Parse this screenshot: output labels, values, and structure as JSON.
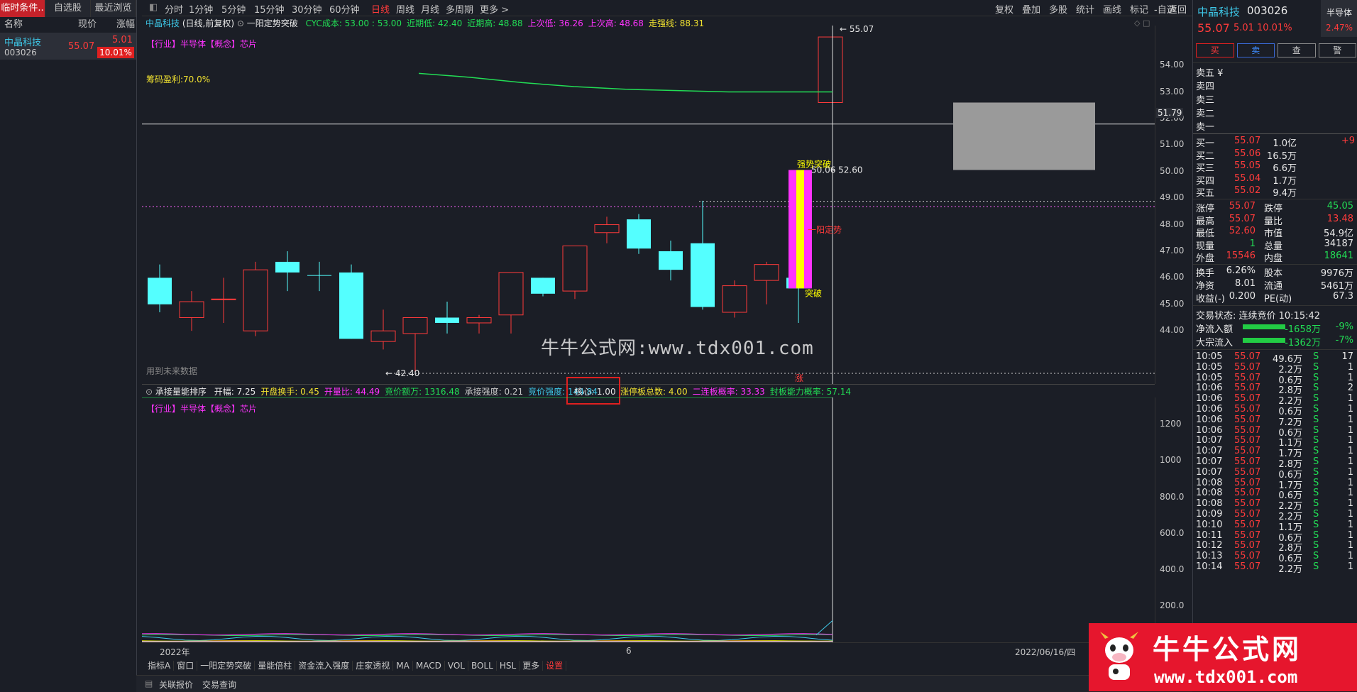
{
  "left": {
    "tabs": [
      "临时条件..",
      "自选股",
      "最近浏览"
    ],
    "headers": [
      "名称",
      "现价",
      "涨幅"
    ],
    "stock": {
      "name": "中晶科技",
      "code": "003026",
      "price": "55.07",
      "change": "5.01",
      "pct": "10.01%"
    }
  },
  "toolbar": {
    "periods": [
      "分时",
      "1分钟",
      "5分钟",
      "15分钟",
      "30分钟",
      "60分钟",
      "日线",
      "周线",
      "月线",
      "多周期",
      "更多 >"
    ],
    "right_buttons": [
      "复权",
      "叠加",
      "多股",
      "统计",
      "画线",
      "标记",
      "-自选",
      "返回"
    ]
  },
  "main_chart": {
    "title": "中晶科技",
    "subtitle": "(日线,前复权)",
    "indicator": "一阳定势突破",
    "stats": [
      {
        "label": "CYC成本: 53.00 : 53.00",
        "color": "#22dd55"
      },
      {
        "label": "近期低: 42.40",
        "color": "#22dd55"
      },
      {
        "label": "近期高: 48.88",
        "color": "#22dd55"
      },
      {
        "label": "上次低: 36.26",
        "color": "#ff33ff"
      },
      {
        "label": "上次高: 48.68",
        "color": "#ff33ff"
      },
      {
        "label": "走强线: 88.31",
        "color": "#f0e130"
      }
    ],
    "sector": "【行业】半导体【概念】芯片",
    "chip_profit": "筹码盈利:70.0%",
    "future_note": "用到未来数据",
    "high_label": "55.07",
    "low_label": "42.40",
    "crosshair_value": "51.79",
    "box_label": "50.06",
    "box_price": "52.60",
    "strong_break": "强势突破",
    "yiyang": "一阳定势",
    "tupo": "突破",
    "zhang": "涨",
    "yaxis": [
      "54.00",
      "53.00",
      "52.00",
      "51.00",
      "50.00",
      "49.00",
      "48.00",
      "47.00",
      "46.00",
      "45.00",
      "44.00"
    ]
  },
  "sub_chart": {
    "title": "承接量能排序",
    "stats": [
      {
        "label": "开幅: 7.25",
        "color": "#e8e8e8"
      },
      {
        "label": "开盘换手: 0.45",
        "color": "#f0e130"
      },
      {
        "label": "开量比: 44.49",
        "color": "#ff33ff"
      },
      {
        "label": "竞价额万: 1316.48",
        "color": "#22dd55"
      },
      {
        "label": "承接强度: 0.21",
        "color": "#c8c8c8"
      },
      {
        "label": "竞价强度: 144.84",
        "color": "#3ec8e8"
      }
    ],
    "core": "核心: 1.00",
    "stats2": [
      {
        "label": "涨停板总数: 4.00",
        "color": "#f0e130"
      },
      {
        "label": "二连板概率: 33.33",
        "color": "#ff33ff"
      },
      {
        "label": "封板能力概率: 57.14",
        "color": "#22dd55"
      }
    ],
    "sector": "【行业】半导体【概念】芯片",
    "yaxis": [
      "1200",
      "1000",
      "800.0",
      "600.0",
      "400.0",
      "200.0"
    ]
  },
  "xaxis": {
    "start": "2022年",
    "mid": "6",
    "date": "2022/06/16/四"
  },
  "bottom_tabs": [
    "指标A",
    "窗口",
    "一阳定势突破",
    "量能倍柱",
    "资金流入强度",
    "庄家透视",
    "MA",
    "MACD",
    "VOL",
    "BOLL",
    "HSL",
    "更多",
    "设置"
  ],
  "status_tabs": [
    "关联报价",
    "交易查询"
  ],
  "watermark": "牛牛公式网:www.tdx001.com",
  "logo": {
    "title": "牛牛公式网",
    "url": "www.tdx001.com"
  },
  "right": {
    "name": "中晶科技",
    "code": "003026",
    "sector": "半导体",
    "price": "55.07",
    "change": "5.01",
    "pct": "10.01%",
    "sector_pct": "2.47%",
    "actions": [
      "买",
      "卖",
      "查",
      "警"
    ],
    "sell": [
      "卖五 ¥",
      "卖四",
      "卖三",
      "卖二",
      "卖一"
    ],
    "buy": [
      {
        "l": "买一",
        "p": "55.07",
        "v": "1.0亿",
        "d": "+9"
      },
      {
        "l": "买二",
        "p": "55.06",
        "v": "16.5万",
        "d": ""
      },
      {
        "l": "买三",
        "p": "55.05",
        "v": "6.6万",
        "d": ""
      },
      {
        "l": "买四",
        "p": "55.04",
        "v": "1.7万",
        "d": ""
      },
      {
        "l": "买五",
        "p": "55.02",
        "v": "9.4万",
        "d": ""
      }
    ],
    "quote": [
      [
        "涨停",
        "55.07",
        "跌停",
        "45.05"
      ],
      [
        "最高",
        "55.07",
        "量比",
        "13.48"
      ],
      [
        "最低",
        "52.60",
        "市值",
        "54.9亿"
      ],
      [
        "现量",
        "1",
        "总量",
        "34187"
      ],
      [
        "外盘",
        "15546",
        "内盘",
        "18641"
      ]
    ],
    "quote2": [
      [
        "换手",
        "6.26%",
        "股本",
        "9976万"
      ],
      [
        "净资",
        "8.01",
        "流通",
        "5461万"
      ],
      [
        "收益(-)",
        "0.200",
        "PE(动)",
        "67.3"
      ]
    ],
    "status": "交易状态: 连续竞价 10:15:42",
    "flows": [
      {
        "l": "净流入额",
        "v": "-1658万",
        "p": "-9%"
      },
      {
        "l": "大宗流入",
        "v": "-1362万",
        "p": "-7%"
      }
    ],
    "ticks": [
      [
        "10:05",
        "55.07",
        "49.6万",
        "S",
        "17"
      ],
      [
        "10:05",
        "55.07",
        "2.2万",
        "S",
        "1"
      ],
      [
        "10:05",
        "55.07",
        "0.6万",
        "S",
        "1"
      ],
      [
        "10:06",
        "55.07",
        "2.8万",
        "S",
        "2"
      ],
      [
        "10:06",
        "55.07",
        "2.2万",
        "S",
        "1"
      ],
      [
        "10:06",
        "55.07",
        "0.6万",
        "S",
        "1"
      ],
      [
        "10:06",
        "55.07",
        "7.2万",
        "S",
        "1"
      ],
      [
        "10:06",
        "55.07",
        "0.6万",
        "S",
        "1"
      ],
      [
        "10:07",
        "55.07",
        "1.1万",
        "S",
        "1"
      ],
      [
        "10:07",
        "55.07",
        "1.7万",
        "S",
        "1"
      ],
      [
        "10:07",
        "55.07",
        "2.8万",
        "S",
        "1"
      ],
      [
        "10:07",
        "55.07",
        "0.6万",
        "S",
        "1"
      ],
      [
        "10:08",
        "55.07",
        "1.7万",
        "S",
        "1"
      ],
      [
        "10:08",
        "55.07",
        "0.6万",
        "S",
        "1"
      ],
      [
        "10:08",
        "55.07",
        "2.2万",
        "S",
        "1"
      ],
      [
        "10:09",
        "55.07",
        "2.2万",
        "S",
        "1"
      ],
      [
        "10:10",
        "55.07",
        "1.1万",
        "S",
        "1"
      ],
      [
        "10:11",
        "55.07",
        "0.6万",
        "S",
        "1"
      ],
      [
        "10:12",
        "55.07",
        "2.8万",
        "S",
        "1"
      ],
      [
        "10:13",
        "55.07",
        "0.6万",
        "S",
        "1"
      ],
      [
        "10:14",
        "55.07",
        "2.2万",
        "S",
        "1"
      ]
    ]
  },
  "chart_data": {
    "type": "candlestick",
    "candles": [
      {
        "o": 46.0,
        "h": 46.5,
        "l": 44.7,
        "c": 45.0,
        "up": false
      },
      {
        "o": 44.5,
        "h": 45.5,
        "l": 44.0,
        "c": 45.1,
        "up": true
      },
      {
        "o": 45.2,
        "h": 46.0,
        "l": 44.3,
        "c": 45.2,
        "up": true
      },
      {
        "o": 44.0,
        "h": 46.6,
        "l": 43.8,
        "c": 46.3,
        "up": true
      },
      {
        "o": 46.6,
        "h": 47.0,
        "l": 45.5,
        "c": 46.2,
        "up": false
      },
      {
        "o": 46.1,
        "h": 46.6,
        "l": 45.5,
        "c": 46.1,
        "up": false
      },
      {
        "o": 46.2,
        "h": 46.5,
        "l": 43.7,
        "c": 43.7,
        "up": false
      },
      {
        "o": 43.6,
        "h": 44.8,
        "l": 43.3,
        "c": 44.0,
        "up": true
      },
      {
        "o": 43.9,
        "h": 44.5,
        "l": 42.4,
        "c": 44.5,
        "up": true
      },
      {
        "o": 44.5,
        "h": 45.1,
        "l": 43.9,
        "c": 44.3,
        "up": false
      },
      {
        "o": 44.3,
        "h": 44.6,
        "l": 43.9,
        "c": 44.5,
        "up": true
      },
      {
        "o": 44.6,
        "h": 46.2,
        "l": 43.9,
        "c": 46.2,
        "up": true
      },
      {
        "o": 46.0,
        "h": 46.0,
        "l": 45.3,
        "c": 45.4,
        "up": false
      },
      {
        "o": 45.5,
        "h": 47.2,
        "l": 45.2,
        "c": 47.2,
        "up": true
      },
      {
        "o": 47.7,
        "h": 48.3,
        "l": 47.3,
        "c": 48.0,
        "up": true
      },
      {
        "o": 48.2,
        "h": 48.4,
        "l": 46.9,
        "c": 47.1,
        "up": false
      },
      {
        "o": 47.0,
        "h": 47.4,
        "l": 45.9,
        "c": 46.3,
        "up": false
      },
      {
        "o": 47.3,
        "h": 48.9,
        "l": 44.8,
        "c": 44.9,
        "up": false
      },
      {
        "o": 44.7,
        "h": 45.9,
        "l": 44.5,
        "c": 45.7,
        "up": true
      },
      {
        "o": 45.9,
        "h": 46.6,
        "l": 45.0,
        "c": 46.5,
        "up": true
      },
      {
        "o": 46.0,
        "h": 46.3,
        "l": 44.3,
        "c": 45.6,
        "up": false
      },
      {
        "o": 52.6,
        "h": 55.07,
        "l": 52.6,
        "c": 55.07,
        "up": true
      }
    ],
    "cyc_line": [
      53.7,
      53.55,
      53.35,
      53.2,
      53.1,
      53.05,
      53.0,
      53.0,
      53.0
    ],
    "ylim": [
      42.0,
      55.5
    ]
  }
}
